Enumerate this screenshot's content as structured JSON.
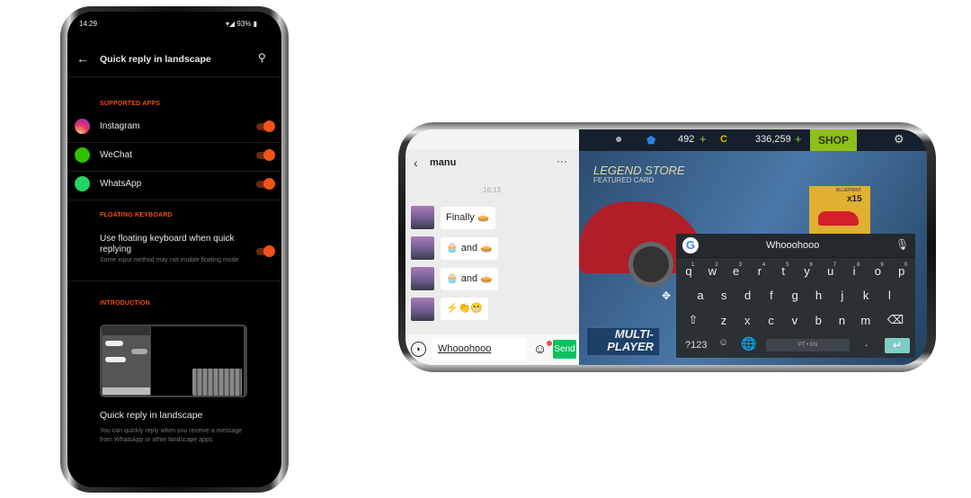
{
  "settings_phone": {
    "status": {
      "time": "14:29",
      "battery": "93%"
    },
    "header": {
      "title": "Quick reply in landscape"
    },
    "sections": {
      "supported_apps": "SUPPORTED APPS",
      "floating_keyboard": "FLOATING KEYBOARD",
      "introduction": "INTRODUCTION"
    },
    "apps": [
      {
        "name": "Instagram",
        "enabled": true
      },
      {
        "name": "WeChat",
        "enabled": true
      },
      {
        "name": "WhatsApp",
        "enabled": true
      }
    ],
    "floating": {
      "title": "Use floating keyboard when quick replying",
      "subtitle": "Some input method may not enable floating mode",
      "enabled": true
    },
    "intro": {
      "title": "Quick reply in landscape",
      "description": "You can quickly reply when you receive a message from WhatsApp or other landscape apps"
    },
    "accent": "#f05317"
  },
  "landscape_phone": {
    "chat": {
      "contact": "manu",
      "time": "16:13",
      "messages": [
        "Finally 🥧",
        "🧁 and 🥧",
        "🧁 and 🥧",
        "⚡👏😬"
      ],
      "input_value": "Whooohooo",
      "send_label": "Send"
    },
    "game": {
      "gems": "492",
      "coins": "336,259",
      "shop": "SHOP",
      "store_title": "LEGEND STORE",
      "store_subtitle": "FEATURED CARD",
      "card_label": "BLUEPRINT",
      "card_count": "x15",
      "mode": "MULTI-PLAYER"
    },
    "keyboard": {
      "suggestion": "Whooohooo",
      "row1": [
        "q",
        "w",
        "e",
        "r",
        "t",
        "y",
        "u",
        "i",
        "o",
        "p"
      ],
      "row1_sup": [
        "1",
        "2",
        "3",
        "4",
        "5",
        "6",
        "7",
        "8",
        "9",
        "0"
      ],
      "row2": [
        "a",
        "s",
        "d",
        "f",
        "g",
        "h",
        "j",
        "k",
        "l"
      ],
      "row3": [
        "z",
        "x",
        "c",
        "v",
        "b",
        "n",
        "m"
      ],
      "symbols": "?123",
      "space": "PT • EN",
      "period": "."
    }
  }
}
